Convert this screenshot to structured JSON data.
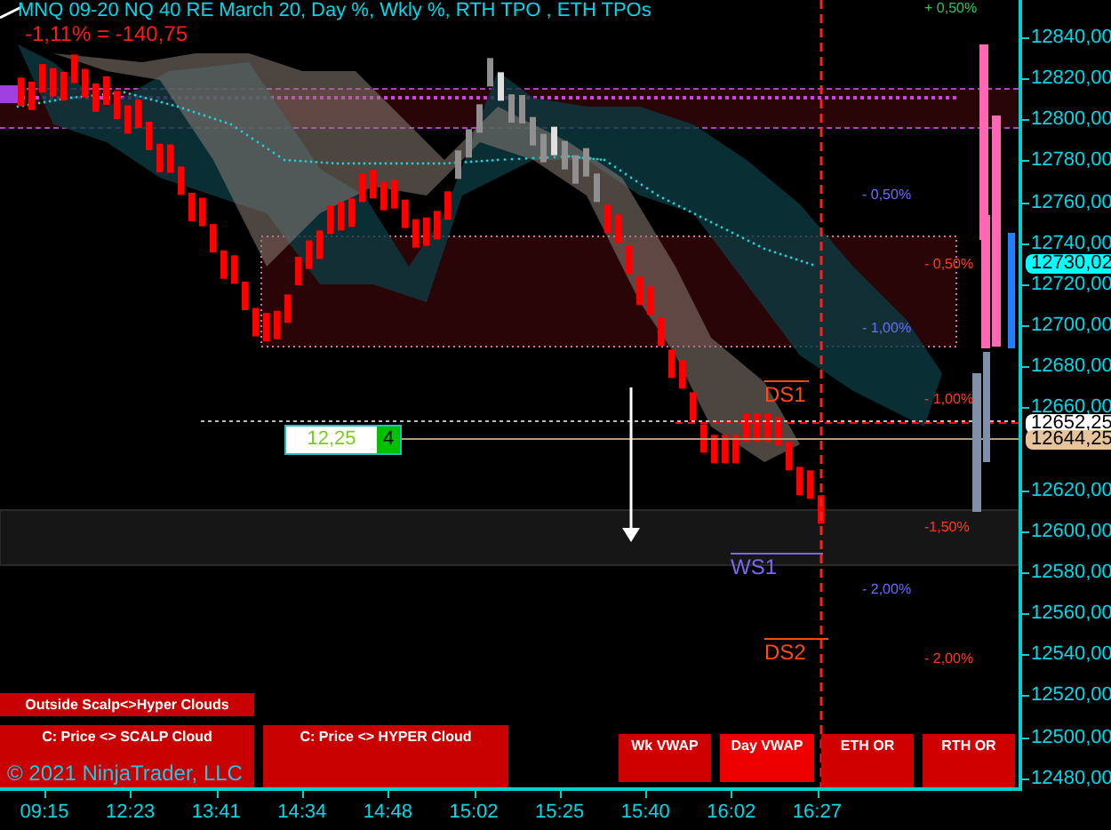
{
  "chart": {
    "title": "MNQ 09-20 NQ 40 RE March 20, Day %, Wkly %, RTH TPO , ETH TPOs",
    "change": "-1,11% = -140,75",
    "percent_levels": [
      {
        "text": "+ 0,50%",
        "color": "#22c55e"
      },
      {
        "text": "- 0,50%",
        "color": "#6b6bff"
      },
      {
        "text": "- 0,50%",
        "color": "#ff3b1f"
      },
      {
        "text": "- 1,00%",
        "color": "#6b6bff"
      },
      {
        "text": "- 1,00%",
        "color": "#ff3b1f"
      },
      {
        "text": "-1,50%",
        "color": "#ff3b1f"
      },
      {
        "text": "- 2,00%",
        "color": "#6b6bff"
      },
      {
        "text": "- 2,00%",
        "color": "#ff3b1f"
      }
    ],
    "pivots": [
      {
        "text": "DS1",
        "color": "#ff4a14"
      },
      {
        "text": "WS1",
        "color": "#7b68ee"
      },
      {
        "text": "DS2",
        "color": "#ff4a14"
      }
    ],
    "order": {
      "value": "12,25",
      "quantity": "4"
    },
    "copyright": "© 2021 NinjaTrader, LLC"
  },
  "buttons": [
    {
      "label": "Outside Scalp<>Hyper Clouds"
    },
    {
      "label": "C: Price <> SCALP Cloud"
    },
    {
      "label": "C: Price <> HYPER Cloud"
    },
    {
      "label": "Wk VWAP"
    },
    {
      "label": "Day VWAP"
    },
    {
      "label": "ETH OR"
    },
    {
      "label": "RTH OR"
    }
  ],
  "price_axis": [
    "12840,00",
    "12820,00",
    "12800,00",
    "12780,00",
    "12760,00",
    "12740,00",
    "12720,00",
    "12700,00",
    "12680,00",
    "12660,00",
    "12620,00",
    "12600,00",
    "12580,00",
    "12560,00",
    "12540,00",
    "12520,00",
    "12500,00",
    "12480,00"
  ],
  "price_tags": [
    {
      "text": "12730,02",
      "color": "#00ffff"
    },
    {
      "text": "12652,25",
      "color": "#ffffff"
    },
    {
      "text": "12644,25",
      "color": "#e8c49a"
    }
  ],
  "time_axis": [
    "09:15",
    "12:23",
    "13:41",
    "14:34",
    "14:48",
    "15:02",
    "15:25",
    "15:40",
    "16:02",
    "16:27"
  ]
}
